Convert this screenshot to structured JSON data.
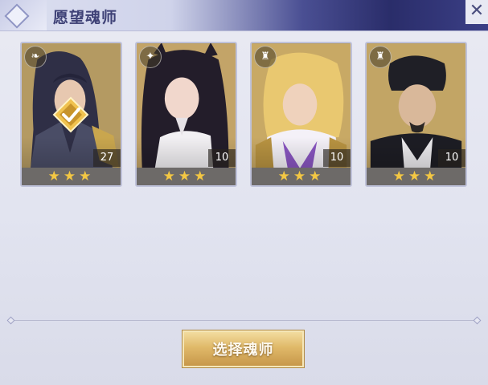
{
  "header": {
    "title": "愿望魂师",
    "close_label": "✕"
  },
  "cards": [
    {
      "class_icon": "wing-icon",
      "class_glyph": "❧",
      "level": "27",
      "stars": "★★★",
      "selected": true
    },
    {
      "class_icon": "bird-icon",
      "class_glyph": "✦",
      "level": "10",
      "stars": "★★★",
      "selected": false
    },
    {
      "class_icon": "tower-icon",
      "class_glyph": "♜",
      "level": "10",
      "stars": "★★★",
      "selected": false
    },
    {
      "class_icon": "tower-icon",
      "class_glyph": "♜",
      "level": "10",
      "stars": "★★★",
      "selected": false
    }
  ],
  "footer": {
    "select_label": "选择魂师"
  },
  "colors": {
    "star": "#f3c743",
    "button_gold": "#e0b969",
    "title": "#3e4176"
  }
}
